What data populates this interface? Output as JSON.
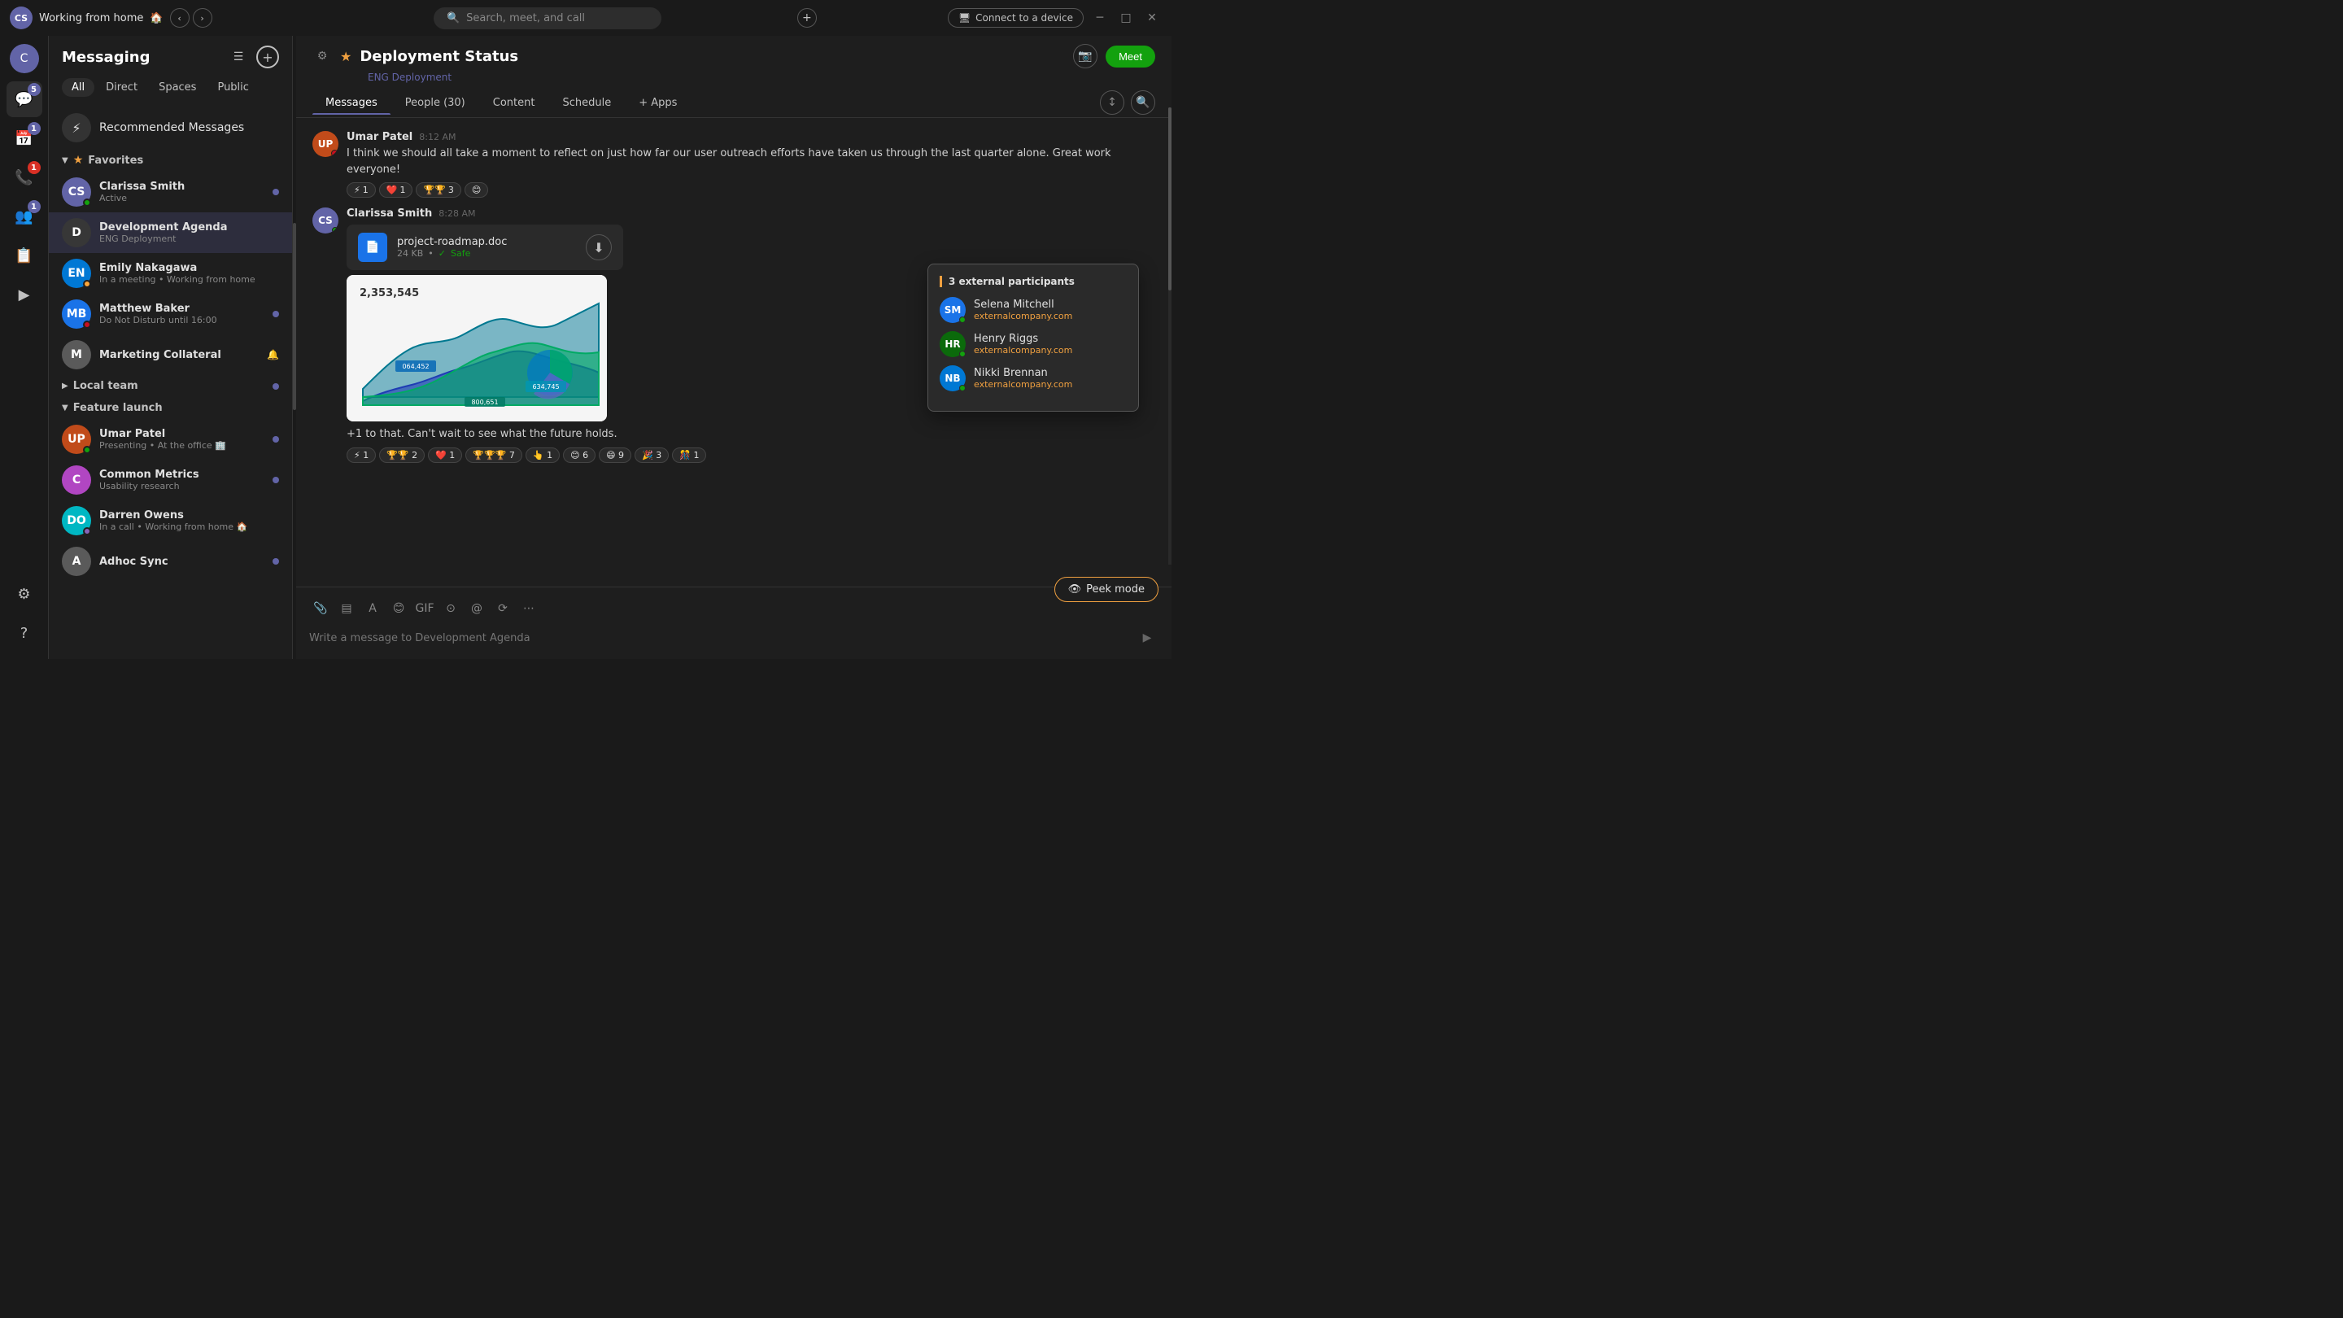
{
  "window": {
    "title": "Working from home",
    "emoji": "🏠",
    "search_placeholder": "Search, meet, and call",
    "connect_label": "Connect to a device"
  },
  "messaging": {
    "title": "Messaging",
    "tabs": [
      {
        "label": "All",
        "active": true
      },
      {
        "label": "Direct"
      },
      {
        "label": "Spaces"
      },
      {
        "label": "Public"
      }
    ],
    "recommended_label": "Recommended Messages",
    "sections": {
      "favorites": {
        "label": "Favorites",
        "items": [
          {
            "name": "Clarissa Smith",
            "status": "Active",
            "status_type": "active",
            "avatar_text": "CS",
            "avatar_color": "av-purple",
            "has_dot": true,
            "selected": false
          },
          {
            "name": "Development Agenda",
            "status": "ENG Deployment",
            "status_type": "group",
            "avatar_text": "D",
            "avatar_color": "av-dark",
            "has_dot": false,
            "selected": true
          },
          {
            "name": "Emily Nakagawa",
            "status": "In a meeting • Working from home",
            "status_type": "away",
            "avatar_text": "EN",
            "avatar_color": "av-teal",
            "has_dot": false,
            "selected": false
          },
          {
            "name": "Matthew Baker",
            "status": "Do Not Disturb until 16:00",
            "status_type": "dnd",
            "avatar_text": "MB",
            "avatar_color": "av-blue",
            "has_dot": true,
            "selected": false
          },
          {
            "name": "Marketing Collateral",
            "status": "",
            "status_type": "mute",
            "avatar_text": "M",
            "avatar_color": "av-gray",
            "has_dot": false,
            "selected": false
          }
        ]
      },
      "local_team": {
        "label": "Local team",
        "has_dot": true
      },
      "feature_launch": {
        "label": "Feature launch",
        "items": [
          {
            "name": "Umar Patel",
            "status": "Presenting • At the office 🏢",
            "status_type": "active",
            "avatar_text": "UP",
            "avatar_color": "av-orange",
            "has_dot": true
          },
          {
            "name": "Common Metrics",
            "status": "Usability research",
            "status_type": "group",
            "avatar_text": "C",
            "avatar_color": "av-pink",
            "has_dot": true
          },
          {
            "name": "Darren Owens",
            "status": "In a call • Working from home 🏠",
            "status_type": "call",
            "avatar_text": "DO",
            "avatar_color": "av-cyan",
            "has_dot": false
          },
          {
            "name": "Adhoc Sync",
            "status": "",
            "status_type": "group",
            "avatar_text": "A",
            "avatar_color": "av-gray",
            "has_dot": true
          }
        ]
      }
    }
  },
  "channel": {
    "title": "Deployment Status",
    "subtitle": "ENG Deployment",
    "meet_label": "Meet",
    "tabs": [
      {
        "label": "Messages",
        "active": true
      },
      {
        "label": "People (30)"
      },
      {
        "label": "Content"
      },
      {
        "label": "Schedule"
      },
      {
        "label": "+ Apps"
      }
    ]
  },
  "messages": [
    {
      "author": "Umar Patel",
      "time": "8:12 AM",
      "text": "I think we should all take a moment to reflect on just how far our user outreach efforts have taken us through the last quarter alone. Great work everyone!",
      "avatar_text": "UP",
      "avatar_color": "av-orange",
      "reactions": [
        {
          "emoji": "⚡",
          "count": "1"
        },
        {
          "emoji": "❤️",
          "count": "1"
        },
        {
          "emoji": "🏆🏆",
          "count": "3"
        },
        {
          "emoji": "😊",
          "count": ""
        }
      ]
    },
    {
      "author": "Clarissa Smith",
      "time": "8:28 AM",
      "text": "+1 to that. Can't wait to see what the future holds.",
      "avatar_text": "CS",
      "avatar_color": "av-purple",
      "has_online": true,
      "file": {
        "name": "project-roadmap.doc",
        "size": "24 KB",
        "safe": "Safe",
        "icon": "📄"
      },
      "has_chart": true,
      "chart_label": "2,353,545",
      "reactions": [
        {
          "emoji": "⚡",
          "count": "1"
        },
        {
          "emoji": "🏆🏆",
          "count": "2"
        },
        {
          "emoji": "❤️",
          "count": "1"
        },
        {
          "emoji": "🏆🏆🏆",
          "count": "7"
        },
        {
          "emoji": "👆",
          "count": "1"
        },
        {
          "emoji": "😊",
          "count": "6"
        },
        {
          "emoji": "😄",
          "count": "9"
        },
        {
          "emoji": "🎉",
          "count": "3"
        },
        {
          "emoji": "🎊",
          "count": "1"
        }
      ]
    }
  ],
  "input": {
    "placeholder": "Write a message to Development Agenda"
  },
  "external_popup": {
    "title": "3 external participants",
    "people": [
      {
        "name": "Selena Mitchell",
        "company": "externalcompany.com",
        "avatar_text": "SM",
        "avatar_color": "av-blue"
      },
      {
        "name": "Henry Riggs",
        "company": "externalcompany.com",
        "avatar_text": "HR",
        "avatar_color": "av-green"
      },
      {
        "name": "Nikki Brennan",
        "company": "externalcompany.com",
        "avatar_text": "NB",
        "avatar_color": "av-teal"
      }
    ]
  },
  "peek_mode": {
    "label": "Peek mode"
  }
}
